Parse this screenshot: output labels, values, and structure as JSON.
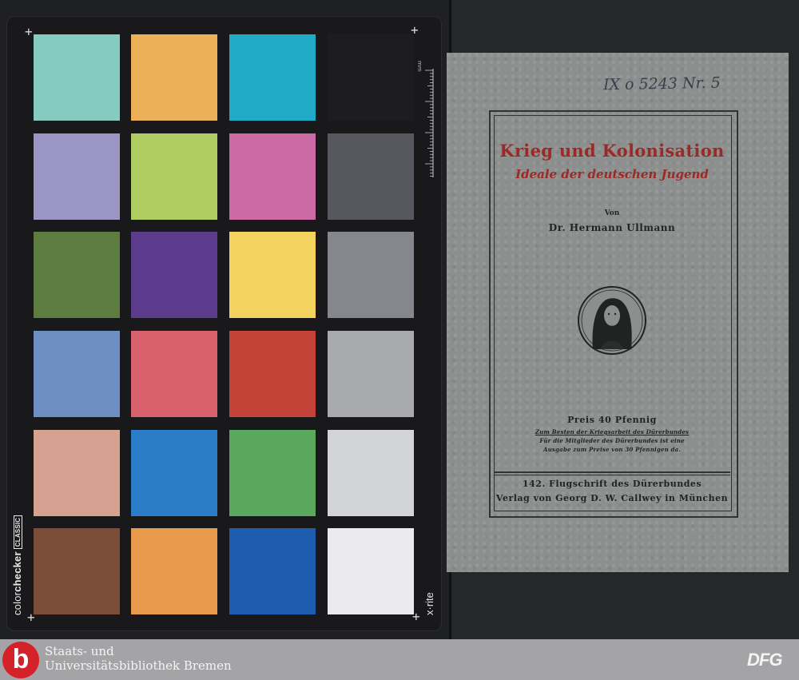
{
  "color_checker": {
    "brand_regular": "color",
    "brand_bold": "checker",
    "brand_variant": "CLASSIC",
    "maker": "x·rite",
    "ruler_unit": "mm",
    "patches": [
      [
        "#86cbbf",
        "#ecb058",
        "#1faac6",
        "#1d1d1f"
      ],
      [
        "#9a95c3",
        "#b0cd64",
        "#cc6aa6",
        "#57585d"
      ],
      [
        "#5d7c3f",
        "#5b3c8c",
        "#f4d25e",
        "#86878d"
      ],
      [
        "#6e8fc2",
        "#d9616d",
        "#c44339",
        "#a9aaae"
      ],
      [
        "#d6a190",
        "#2c7dc8",
        "#5aa85d",
        "#d3d4d6"
      ],
      [
        "#7c4d39",
        "#e89a4d",
        "#1e5cb0",
        "#ebebed"
      ]
    ]
  },
  "booklet": {
    "shelfmark": "IX o 5243 Nr. 5",
    "title": "Krieg und Kolonisation",
    "subtitle": "Ideale der deutschen Jugend",
    "by": "Von",
    "author": "Dr. Hermann Ullmann",
    "price": "Preis 40 Pfennig",
    "note_line1": "Zum Besten der Kriegsarbeit des Dürerbundes",
    "note_line2": "Für die Mitglieder des Dürerbundes ist eine",
    "note_line3": "Ausgabe zum Preise von 30 Pfennigen da.",
    "series": "142. Flugschrift des Dürerbundes",
    "publisher": "Verlag von Georg D. W. Callwey in München",
    "title_color": "#9b2a26"
  },
  "footer": {
    "logo_letter": "b",
    "institution_line1": "Staats- und",
    "institution_line2": "Universitätsbibliothek Bremen",
    "funder": "DFG",
    "logo_color": "#d4212a"
  }
}
